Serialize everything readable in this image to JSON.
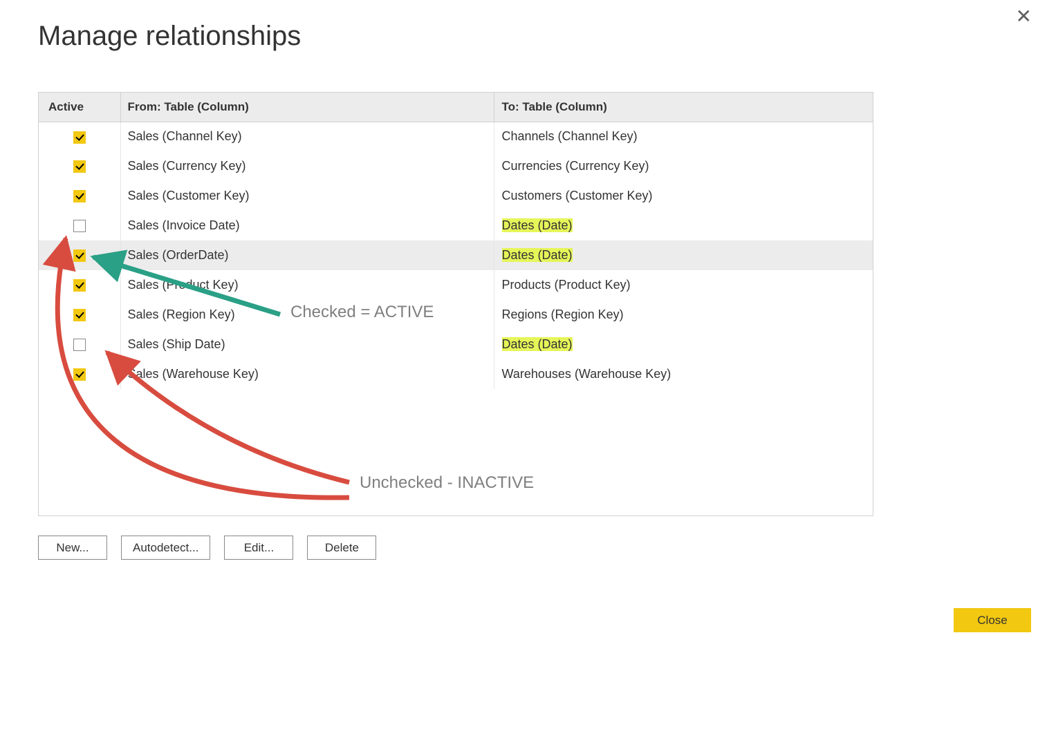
{
  "dialog": {
    "title": "Manage relationships",
    "columns": {
      "active": "Active",
      "from": "From: Table (Column)",
      "to": "To: Table (Column)"
    },
    "close_label": "Close"
  },
  "rows": [
    {
      "active": true,
      "from": "Sales (Channel Key)",
      "to": "Channels (Channel Key)",
      "to_hl": false,
      "selected": false
    },
    {
      "active": true,
      "from": "Sales (Currency Key)",
      "to": "Currencies (Currency Key)",
      "to_hl": false,
      "selected": false
    },
    {
      "active": true,
      "from": "Sales (Customer Key)",
      "to": "Customers (Customer Key)",
      "to_hl": false,
      "selected": false
    },
    {
      "active": false,
      "from": "Sales (Invoice Date)",
      "to": "Dates (Date)",
      "to_hl": true,
      "selected": false
    },
    {
      "active": true,
      "from": "Sales (OrderDate)",
      "to": "Dates (Date)",
      "to_hl": true,
      "selected": true
    },
    {
      "active": true,
      "from": "Sales (Product Key)",
      "to": "Products (Product Key)",
      "to_hl": false,
      "selected": false
    },
    {
      "active": true,
      "from": "Sales (Region Key)",
      "to": "Regions (Region Key)",
      "to_hl": false,
      "selected": false
    },
    {
      "active": false,
      "from": "Sales (Ship Date)",
      "to": "Dates (Date)",
      "to_hl": true,
      "selected": false
    },
    {
      "active": true,
      "from": "Sales (Warehouse Key)",
      "to": "Warehouses (Warehouse Key)",
      "to_hl": false,
      "selected": false
    }
  ],
  "buttons": {
    "new": "New...",
    "autodetect": "Autodetect...",
    "edit": "Edit...",
    "delete": "Delete"
  },
  "annotations": {
    "checked": "Checked = ACTIVE",
    "unchecked": "Unchecked - INACTIVE"
  }
}
